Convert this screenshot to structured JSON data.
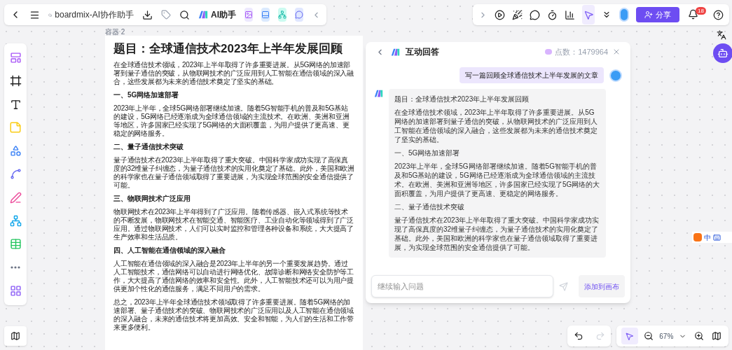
{
  "top_toolbar": {
    "file_name": "boardmix-AI协作助手",
    "ai_button": "AI助手"
  },
  "top_right": {
    "share_button": "分享",
    "notification_count": "18"
  },
  "container_label": "容器 2",
  "document": {
    "title": "题目：全球通信技术2023年上半年发展回顾",
    "blocks": [
      {
        "kind": "paragraph",
        "text": "在全球通信技术领域，2023年上半年取得了许多重要进展。从5G网络的加速部署到量子通信的突破，从物联网技术的广泛应用到人工智能在通信领域的深入融合，这些发展都为未来的通信技术奠定了坚实的基础。"
      },
      {
        "kind": "heading",
        "text": "一、5G网络加速部署"
      },
      {
        "kind": "paragraph",
        "text": "2023年上半年，全球5G网络部署继续加速。随着5G智能手机的普及和5G基站的建设，5G网络已经逐渐成为全球通信领域的主流技术。在欧洲、美洲和亚洲等地区，许多国家已经实现了5G网络的大面积覆盖，为用户提供了更高速、更稳定的网络服务。"
      },
      {
        "kind": "heading",
        "text": "二、量子通信技术突破"
      },
      {
        "kind": "paragraph",
        "text": "量子通信技术在2023年上半年取得了重大突破。中国科学家成功实现了高保真度的32维量子纠缠态，为量子通信技术的实用化奠定了基础。此外，美国和欧洲的科学家也在量子通信领域取得了重要进展，为实现全球范围的安全通信提供了可能。"
      },
      {
        "kind": "heading",
        "text": "三、物联网技术广泛应用"
      },
      {
        "kind": "paragraph",
        "text": "物联网技术在2023年上半年得到了广泛应用。随着传感器、嵌入式系统等技术的不断发展，物联网技术在智能交通、智能医疗、工业自动化等领域得到了广泛应用。通过物联网技术，人们可以实时监控和管理各种设备和系统，大大提高了生产效率和生活品质。"
      },
      {
        "kind": "heading",
        "text": "四、人工智能在通信领域的深入融合"
      },
      {
        "kind": "paragraph",
        "text": "人工智能在通信领域的深入融合是2023年上半年的另一个重要发展趋势。通过人工智能技术，通信网络可以自动进行网络优化、故障诊断和网络安全防护等工作，大大提高了通信网络的效率和安全性。此外，人工智能技术还可以为用户提供更加个性化的通信服务，满足不同用户的需求。"
      },
      {
        "kind": "paragraph",
        "text": "总之，2023年上半年全球通信技术领域取得了许多重要进展。随着5G网络的加速部署、量子通信技术的突破、物联网技术的广泛应用以及人工智能在通信领域的深入融合，未来的通信技术将更加高效、安全和智能，为人们的生活和工作带来更多便利。"
      }
    ]
  },
  "chat": {
    "title": "互动回答",
    "points": "点数：1479964",
    "user_message": "写一篇回顾全球通信技术上半年发展的文章",
    "answer": [
      "题目：全球通信技术2023年上半年发展回顾",
      "在全球通信技术领域，2023年上半年取得了许多重要进展。从5G网络的加速部署到量子通信的突破，从物联网技术的广泛应用到人工智能在通信领域的深入融合，这些发展都为未来的通信技术奠定了坚实的基础。",
      "一、5G网络加速部署",
      "2023年上半年，全球5G网络部署继续加速。随着5G智能手机的普及和5G基站的建设，5G网络已经逐渐成为全球通信领域的主流技术。在欧洲、美洲和亚洲等地区，许多国家已经实现了5G网络的大面积覆盖，为用户提供了更高速、更稳定的网络服务。",
      "二、量子通信技术突破",
      "量子通信技术在2023年上半年取得了重大突破。中国科学家成功实现了高保真度的32维量子纠缠态，为量子通信技术的实用化奠定了基础。此外，美国和欧洲的科学家也在量子通信领域取得了重要进展，为实现全球范围的安全通信提供了可能。"
    ],
    "input": {
      "placeholder": "继续输入问题"
    },
    "add_button": "添加到画布"
  },
  "ime": {
    "mode": "中"
  },
  "zoom": "67%"
}
